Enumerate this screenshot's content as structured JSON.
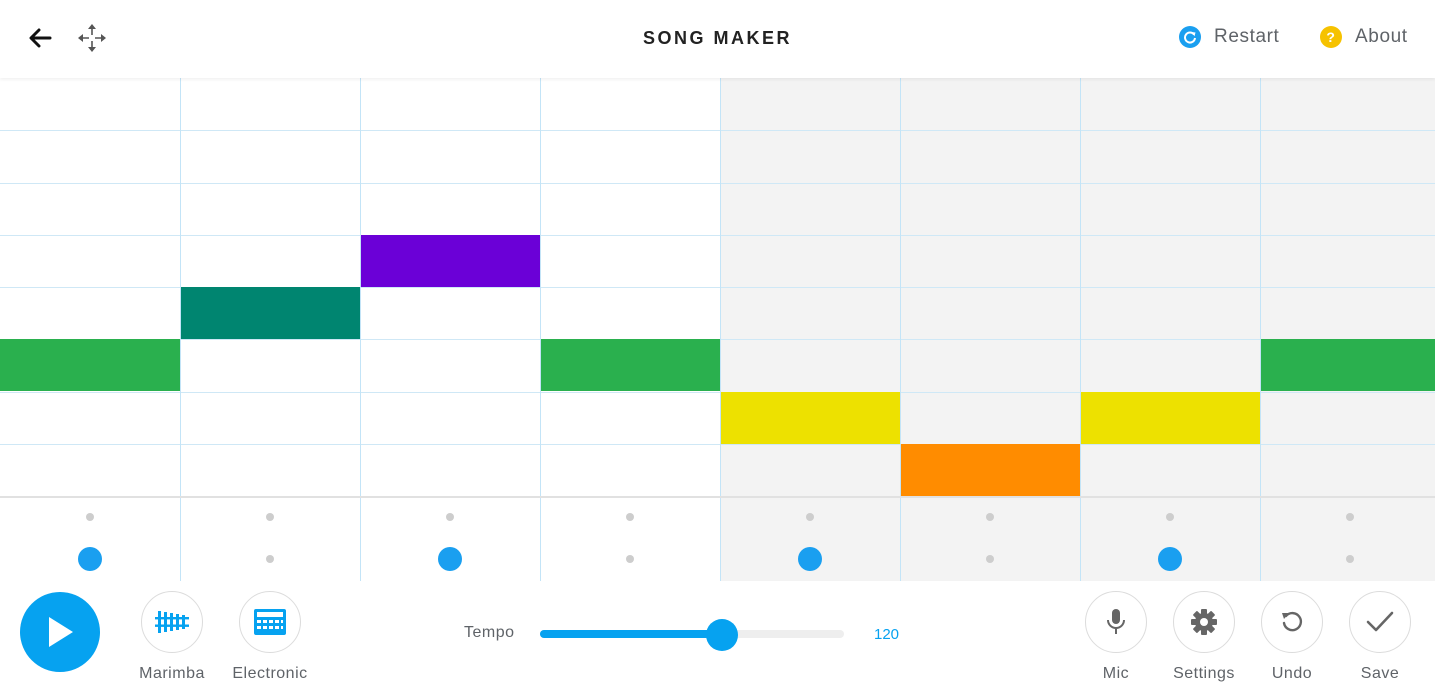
{
  "header": {
    "title": "SONG MAKER",
    "back_icon": "arrow-left-icon",
    "move_icon": "move-arrows-icon",
    "restart_label": "Restart",
    "restart_icon": "refresh-icon",
    "about_label": "About",
    "about_icon": "question-icon",
    "about_icon_glyph": "?"
  },
  "grid": {
    "columns": 8,
    "melody_rows": 8,
    "shaded_columns": [
      4,
      5,
      6,
      7
    ],
    "notes": [
      {
        "col": 0,
        "row": 5,
        "color": "#2ab04e"
      },
      {
        "col": 1,
        "row": 4,
        "color": "#008570"
      },
      {
        "col": 2,
        "row": 3,
        "color": "#6b00d7"
      },
      {
        "col": 3,
        "row": 5,
        "color": "#2ab04e"
      },
      {
        "col": 4,
        "row": 6,
        "color": "#ede100"
      },
      {
        "col": 5,
        "row": 7,
        "color": "#ff8c00"
      },
      {
        "col": 6,
        "row": 6,
        "color": "#ede100"
      },
      {
        "col": 7,
        "row": 5,
        "color": "#2ab04e"
      }
    ],
    "rhythm_top_active": [
      false,
      false,
      false,
      false,
      false,
      false,
      false,
      false
    ],
    "rhythm_bottom_active": [
      true,
      false,
      true,
      false,
      true,
      false,
      true,
      false
    ]
  },
  "controls": {
    "play_icon": "play-icon",
    "instrument_marimba": {
      "label": "Marimba",
      "icon": "marimba-icon"
    },
    "instrument_electronic": {
      "label": "Electronic",
      "icon": "drum-machine-icon"
    },
    "tempo_label": "Tempo",
    "tempo_value": "120",
    "tempo_fraction": 0.6,
    "mic": {
      "label": "Mic",
      "icon": "mic-icon"
    },
    "settings": {
      "label": "Settings",
      "icon": "gear-icon"
    },
    "undo": {
      "label": "Undo",
      "icon": "undo-icon"
    },
    "save": {
      "label": "Save",
      "icon": "check-icon"
    }
  },
  "colors": {
    "accent": "#06a2f0",
    "restart_icon": "#1a9ff0",
    "about_icon": "#f6c200",
    "grid_line": "#c3e4f7",
    "shade": "#f3f3f3"
  }
}
